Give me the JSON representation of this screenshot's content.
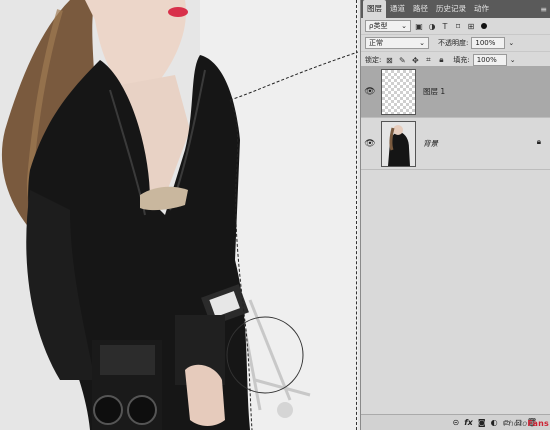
{
  "panel": {
    "tabs": [
      "图层",
      "通道",
      "路径",
      "历史记录",
      "动作"
    ],
    "active_tab": 0,
    "filter_kind": "ρ类型",
    "blend_mode": "正常",
    "opacity_label": "不透明度:",
    "opacity_value": "100%",
    "lock_label": "锁定:",
    "fill_label": "填充:",
    "fill_value": "100%",
    "layers": [
      {
        "name": "图层 1",
        "selected": true,
        "thumbnail": "transparent",
        "visible": true
      },
      {
        "name": "背景",
        "selected": false,
        "thumbnail": "photo",
        "visible": true,
        "locked": true
      }
    ],
    "bottom_icons": [
      "link-icon",
      "fx-icon",
      "mask-icon",
      "adjustment-icon",
      "folder-icon",
      "new-layer-icon",
      "trash-icon"
    ],
    "fx_label": "fx"
  },
  "watermark": {
    "part1": "Photo",
    "part2": "Fans"
  },
  "colors": {
    "panel_bg": "#d9d9d9",
    "tab_bar": "#5a5a5a",
    "selected_layer": "#a9a9a9",
    "watermark_red": "#cc2233"
  }
}
